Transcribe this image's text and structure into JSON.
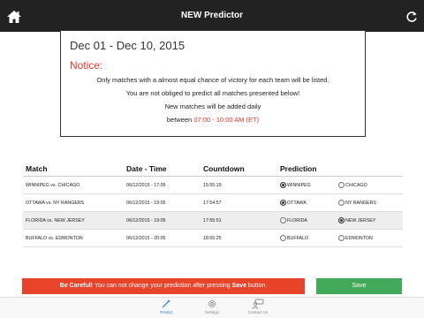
{
  "app": {
    "title": "NEW Predictor"
  },
  "notice_panel": {
    "date_range": "Dec 01 - Dec 10, 2015",
    "heading": "Notice:",
    "line1": "Only matches with a almost equal chance of victory for each team will be listed.",
    "line2": "You are not obliged to predict all matches presented below!",
    "line3": "New matches will be added daily",
    "line4_prefix": "between ",
    "line4_time": "07:00 - 10:00 AM (ET)"
  },
  "table": {
    "headers": {
      "match": "Match",
      "datetime": "Date - Time",
      "countdown": "Countdown",
      "prediction": "Prediction"
    },
    "rows": [
      {
        "match": "WINNIPEG vs. CHICAGO",
        "datetime": "06/12/2015 - 17:05",
        "countdown": "15:55:19",
        "team1": "WINNIPEG",
        "team2": "CHICAGO",
        "selected": "team1"
      },
      {
        "match": "OTTAWA vs. NY RANGERS",
        "datetime": "06/12/2015 - 19:05",
        "countdown": "17:54:57",
        "team1": "OTTAWA",
        "team2": "NY RANGERS",
        "selected": "team1"
      },
      {
        "match": "FLORIDA vs. NEW JERSEY",
        "datetime": "06/12/2015 - 19:05",
        "countdown": "17:55:51",
        "team1": "FLORIDA",
        "team2": "NEW JERSEY",
        "selected": "team2"
      },
      {
        "match": "BUFFALO vs. EDMONTON",
        "datetime": "06/12/2015 - 20:05",
        "countdown": "18:55:25",
        "team1": "BUFFALO",
        "team2": "EDMONTON",
        "selected": "none"
      }
    ]
  },
  "footer": {
    "warning_bold": "Be Careful!",
    "warning_text": " You can not change your prediction after pressing ",
    "warning_save": "Save",
    "warning_end": " button.",
    "save_label": "Save"
  },
  "tabs": [
    {
      "label": "Predict",
      "icon": "wand-icon",
      "active": true
    },
    {
      "label": "Settings",
      "icon": "gear-icon",
      "active": false
    },
    {
      "label": "Contact Us",
      "icon": "contact-icon",
      "active": false
    }
  ],
  "colors": {
    "topbar": "#222222",
    "accent_red": "#e8382b",
    "save_green": "#43a95b",
    "active_tab": "#1e7fd8"
  }
}
